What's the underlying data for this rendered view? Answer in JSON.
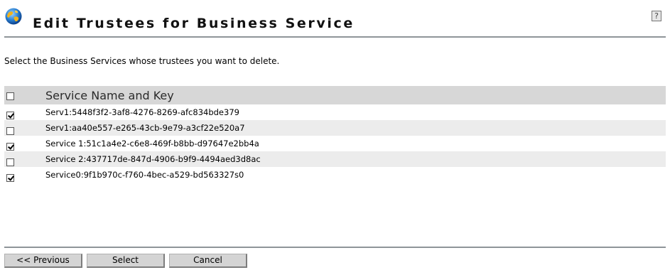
{
  "header": {
    "title": "Edit Trustees for Business Service",
    "help_label": "?"
  },
  "instructions": "Select the Business Services whose trustees you want to delete.",
  "table": {
    "column_header": "Service Name and Key",
    "select_all_checked": false,
    "rows": [
      {
        "label": "Serv1:5448f3f2-3af8-4276-8269-afc834bde379",
        "checked": true
      },
      {
        "label": "Serv1:aa40e557-e265-43cb-9e79-a3cf22e520a7",
        "checked": false
      },
      {
        "label": "Service 1:51c1a4e2-c6e8-469f-b8bb-d97647e2bb4a",
        "checked": true
      },
      {
        "label": "Service 2:437717de-847d-4906-b9f9-4494aed3d8ac",
        "checked": false
      },
      {
        "label": "Service0:9f1b970c-f760-4bec-a529-bd563327s0",
        "checked": true
      }
    ]
  },
  "buttons": {
    "previous": "<< Previous",
    "select": "Select",
    "cancel": "Cancel"
  },
  "colors": {
    "header_row_bg": "#d7d7d7",
    "alt_row_bg": "#ececec",
    "rule": "#8f9599"
  },
  "icons": {
    "header_icon": "globe-icon",
    "help_icon": "help-icon"
  }
}
